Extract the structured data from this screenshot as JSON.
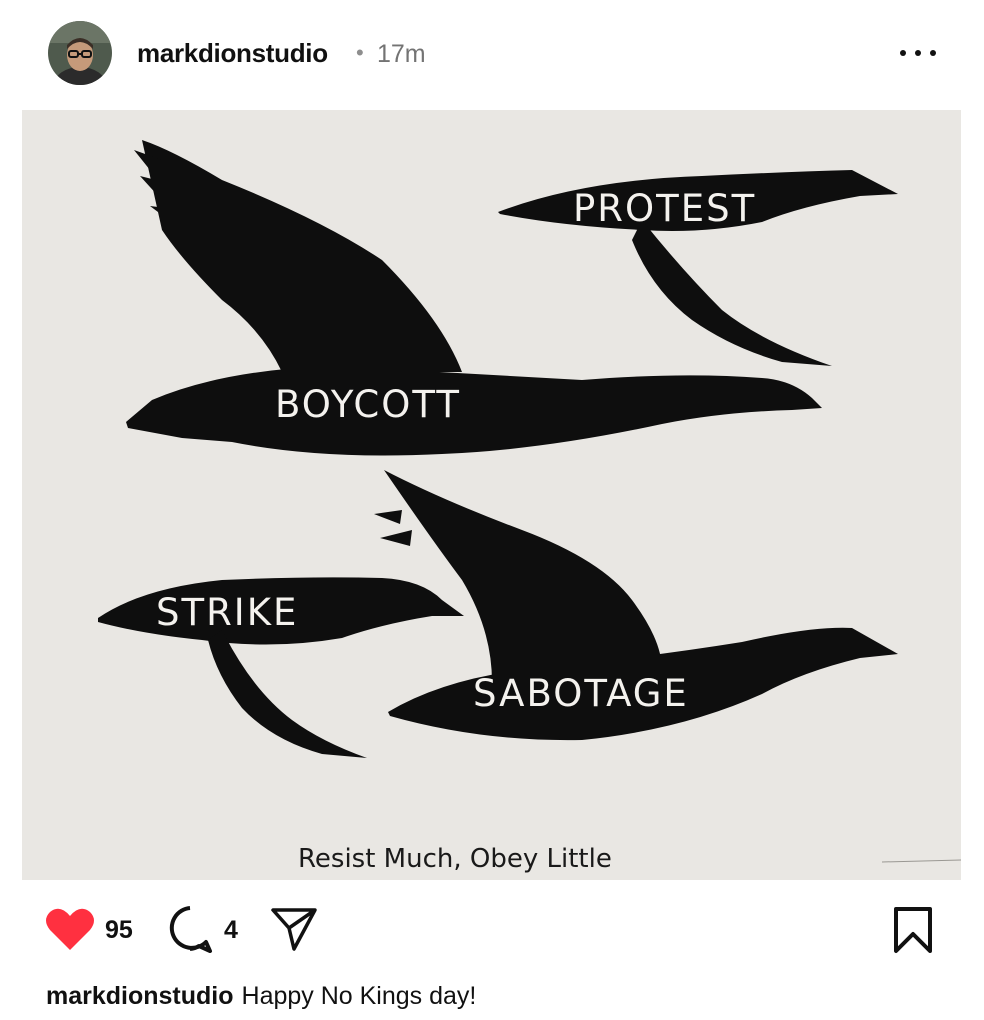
{
  "post": {
    "username": "markdionstudio",
    "separator": "•",
    "time": "17m",
    "likes": "95",
    "comments": "4",
    "caption_user": "markdionstudio",
    "caption_text": "Happy No Kings day!"
  },
  "artwork": {
    "labels": {
      "protest": "PROTEST",
      "boycott": "BOYCOTT",
      "strike": "STRIKE",
      "sabotage": "SABOTAGE"
    },
    "inscription": "Resist Much, Obey Little"
  },
  "icons": {
    "more": "more-options-icon",
    "like": "heart-icon",
    "comment": "comment-icon",
    "share": "paper-plane-icon",
    "save": "bookmark-icon"
  },
  "colors": {
    "like_red": "#ff3040",
    "paper": "#e9e7e3",
    "goose": "#0e0e0e"
  }
}
